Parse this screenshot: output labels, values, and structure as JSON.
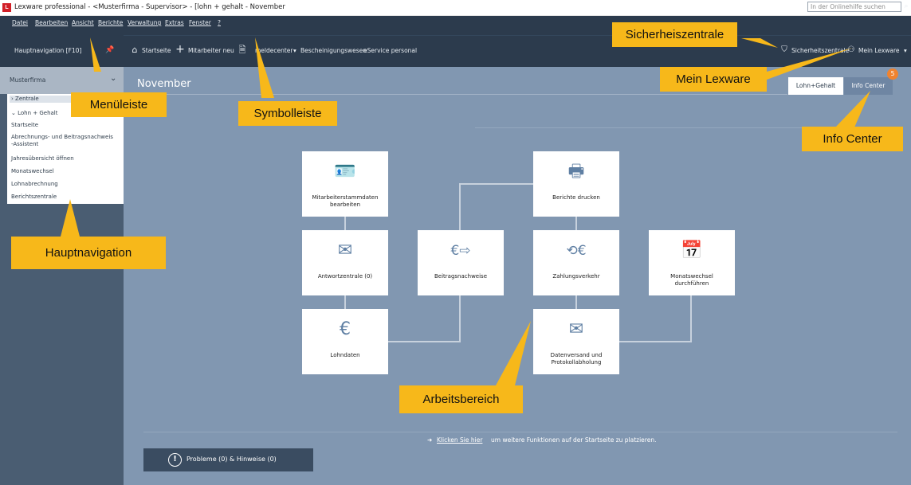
{
  "window": {
    "logo_text": "L",
    "title": "Lexware professional - <Musterfirma - Supervisor> - [lohn + gehalt - November",
    "minimize": "—",
    "maximize": "❐",
    "close": "✕"
  },
  "menubar": {
    "items": [
      "Datei",
      "Bearbeiten",
      "Ansicht",
      "Berichte",
      "Verwaltung",
      "Extras",
      "Fenster",
      "?"
    ],
    "search_placeholder": "In der Onlinehilfe suchen",
    "search_icon": "⌕"
  },
  "toolbar": {
    "hauptnav_label": "Hauptnavigation [F10]",
    "pin_icon": "📌",
    "home_icon": "⌂",
    "startseite": "Startseite",
    "plus_icon": "+",
    "mitarbeiter_neu": "Mitarbeiter neu",
    "doc_icon": "🗎",
    "meldecenter": "meldecenter",
    "dropdown_icon": "▾",
    "bescheinigungswesen": "Bescheinigungswesen",
    "eservice": "eService personal",
    "shield_icon": "⛉",
    "sicherheitszentrale": "Sicherheitszentrale",
    "user_icon": "⚇",
    "mein_lexware": "Mein Lexware",
    "mein_lexware_dropdown": "▾"
  },
  "sidebar": {
    "company": "Musterfirma",
    "company_chevron": "⌄",
    "items": [
      {
        "label": "› Zentrale"
      },
      {
        "label": "⌄ Lohn + Gehalt"
      },
      {
        "label": "Startseite"
      },
      {
        "label": "Abrechnungs- und Beitragsnachweis"
      },
      {
        "label": "-Assistent"
      },
      {
        "label": "Jahresübersicht öffnen"
      },
      {
        "label": "Monatswechsel"
      },
      {
        "label": "Lohnabrechnung"
      },
      {
        "label": "Berichtszentrale"
      }
    ]
  },
  "main": {
    "month": "November",
    "tabs": [
      {
        "label": "Lohn+Gehalt"
      },
      {
        "label": "Info Center"
      }
    ],
    "info_badge": "5",
    "tiles": [
      {
        "icon": "🪪",
        "label1": "Mitarbeiterstammdaten",
        "label2": "bearbeiten"
      },
      {
        "icon": "🖶",
        "label1": "Berichte drucken",
        "label2": ""
      },
      {
        "icon": "✉",
        "label1": "Antwortzentrale (0)",
        "label2": ""
      },
      {
        "icon": "€⇨",
        "label1": "Beitragsnachweise",
        "label2": ""
      },
      {
        "icon": "⟲€",
        "label1": "Zahlungsverkehr",
        "label2": ""
      },
      {
        "icon": "📅",
        "label1": "Monatswechsel",
        "label2": "durchführen"
      },
      {
        "icon": "€",
        "label1": "Lohndaten",
        "label2": ""
      },
      {
        "icon": "✉",
        "label1": "Datenversand und",
        "label2": "Protokollabholung"
      }
    ],
    "hint_arrow": "➜",
    "hint_link": "Klicken Sie hier",
    "hint_rest": " um weitere Funktionen auf der Startseite zu platzieren.",
    "problems_icon": "!",
    "problems_label": "Probleme (0) & Hinweise (0)"
  },
  "callouts": {
    "sicherheitszentrale": "Sicherheiszentrale",
    "mein_lexware": "Mein Lexware",
    "menueleiste": "Menüleiste",
    "symbolleiste": "Symbolleiste",
    "info_center": "Info Center",
    "hauptnavigation": "Hauptnavigation",
    "arbeitsbereich": "Arbeitsbereich"
  },
  "colors": {
    "callout": "#f7b81a",
    "toolbar": "#2c3b4d",
    "main_background": "#8197b1",
    "badge": "#f0832f"
  }
}
